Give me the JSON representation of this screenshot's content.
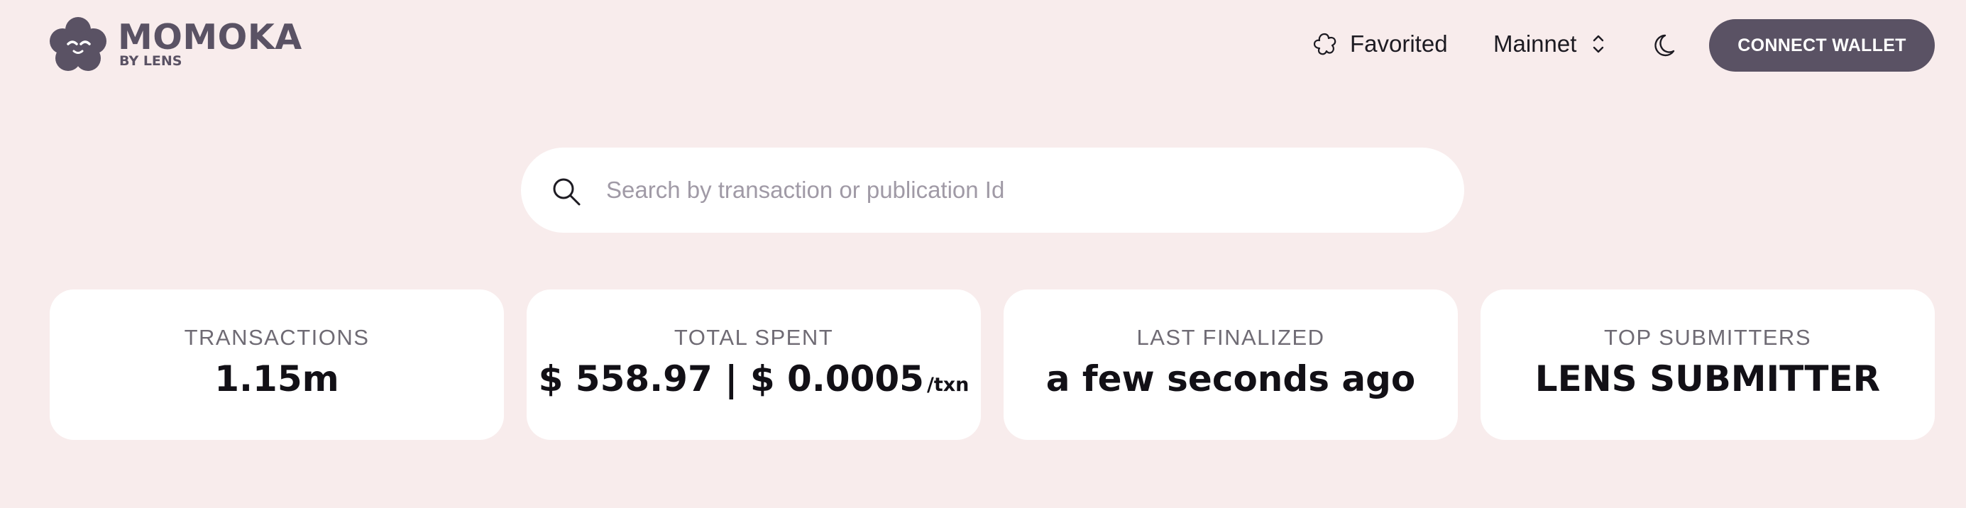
{
  "header": {
    "logo": {
      "title": "MOMOKA",
      "subtitle": "BY LENS"
    },
    "nav": {
      "favorited_label": "Favorited",
      "network_label": "Mainnet",
      "theme_icon": "moon-icon"
    },
    "connect_label": "CONNECT WALLET"
  },
  "search": {
    "placeholder": "Search by transaction or publication Id",
    "value": ""
  },
  "stats": [
    {
      "label": "TRANSACTIONS",
      "value": "1.15m"
    },
    {
      "label": "TOTAL SPENT",
      "value": "$ 558.97 | $ 0.0005",
      "unit": "/txn"
    },
    {
      "label": "LAST FINALIZED",
      "value": "a few seconds ago"
    },
    {
      "label": "TOP SUBMITTERS",
      "value": "LENS SUBMITTER"
    }
  ],
  "colors": {
    "background": "#f8ecec",
    "brand": "#5a5264",
    "card": "#ffffff",
    "label": "#6f6b74"
  }
}
